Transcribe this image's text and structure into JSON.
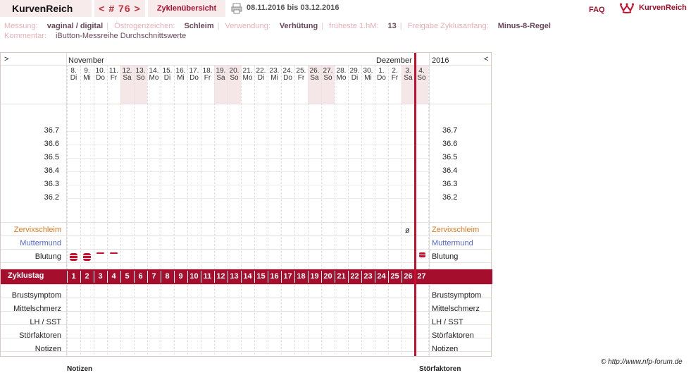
{
  "header": {
    "brand": "KurvenReich",
    "cycle_nav": "< # 76 >",
    "overview": "Zyklenübersicht",
    "date_range": "08.11.2016 bis 03.12.2016",
    "faq": "FAQ",
    "logo_text": "KurvenReich"
  },
  "info": {
    "messung_label": "Messung:",
    "messung_value": "vaginal / digital",
    "oestrogen_label": "Östrogenzeichen:",
    "oestrogen_value": "Schleim",
    "verwendung_label": "Verwendung:",
    "verwendung_value": "Verhütung",
    "fhm_label": "früheste 1.hM:",
    "fhm_value": "13",
    "freigabe_label": "Freigabe Zyklusanfang:",
    "freigabe_value": "Minus-8-Regel",
    "kommentar_label": "Kommentar:",
    "kommentar_value": "iButton-Messreihe Durchschnittswerte"
  },
  "chart": {
    "left_arrow": ">",
    "right_arrow": "<",
    "month_nov": "November",
    "month_dez": "Dezember",
    "year": "2016",
    "days": [
      {
        "d": "8.",
        "w": "Di"
      },
      {
        "d": "9.",
        "w": "Mi"
      },
      {
        "d": "10.",
        "w": "Do"
      },
      {
        "d": "11.",
        "w": "Fr"
      },
      {
        "d": "12.",
        "w": "Sa"
      },
      {
        "d": "13.",
        "w": "So"
      },
      {
        "d": "14.",
        "w": "Mo"
      },
      {
        "d": "15.",
        "w": "Di"
      },
      {
        "d": "16.",
        "w": "Mi"
      },
      {
        "d": "17.",
        "w": "Do"
      },
      {
        "d": "18.",
        "w": "Fr"
      },
      {
        "d": "19.",
        "w": "Sa"
      },
      {
        "d": "20.",
        "w": "So"
      },
      {
        "d": "21.",
        "w": "Mo"
      },
      {
        "d": "22.",
        "w": "Di"
      },
      {
        "d": "23.",
        "w": "Mi"
      },
      {
        "d": "24.",
        "w": "Do"
      },
      {
        "d": "25.",
        "w": "Fr"
      },
      {
        "d": "26.",
        "w": "Sa"
      },
      {
        "d": "27.",
        "w": "So"
      },
      {
        "d": "28.",
        "w": "Mo"
      },
      {
        "d": "29.",
        "w": "Di"
      },
      {
        "d": "30.",
        "w": "Mi"
      },
      {
        "d": "1.",
        "w": "Do"
      },
      {
        "d": "2.",
        "w": "Fr"
      },
      {
        "d": "3.",
        "w": "Sa"
      },
      {
        "d": "4.",
        "w": "So"
      }
    ],
    "temps": [
      "36.7",
      "36.6",
      "36.5",
      "36.4",
      "36.3",
      "36.2"
    ],
    "zervix_label": "Zervixschleim",
    "zervix_symbol": "ø",
    "muttermund_label": "Muttermund",
    "blutung_label": "Blutung",
    "zyklustag_label": "Zyklustag",
    "cycle_days": [
      "1",
      "2",
      "3",
      "4",
      "5",
      "6",
      "7",
      "8",
      "9",
      "10",
      "11",
      "12",
      "13",
      "14",
      "15",
      "16",
      "17",
      "18",
      "19",
      "20",
      "21",
      "22",
      "23",
      "24",
      "25",
      "26",
      "27"
    ],
    "bottom_rows": [
      "Brustsymptom",
      "Mittelschmerz",
      "LH / SST",
      "Störfaktoren",
      "Notizen"
    ],
    "colors": {
      "accent": "#a50f2d",
      "zervix": "#e07a20",
      "muttermund": "#5566cc",
      "weekend": "#f5e6e8"
    }
  },
  "footer": {
    "copyright": "© http://www.nfp-forum.de",
    "notizen_cut": "Notizen",
    "stoerfaktoren_cut": "Störfaktoren"
  }
}
